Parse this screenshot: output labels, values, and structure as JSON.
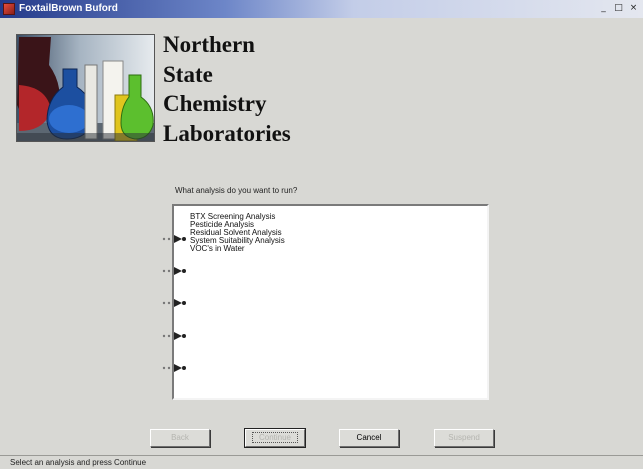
{
  "window": {
    "title": "FoxtailBrown Buford",
    "minimize": "_",
    "maximize": "□",
    "close": "×"
  },
  "logo": {
    "icon": "lab-flasks-image"
  },
  "company": {
    "lines": [
      "Northern",
      "State",
      "Chemistry",
      "Laboratories"
    ]
  },
  "prompt": "What analysis do you want to run?",
  "analyses": [
    "BTX Screening Analysis",
    "Pesticide Analysis",
    "Residual Solvent Analysis",
    "System Suitability Analysis",
    "VOC's in Water"
  ],
  "buttons": {
    "back": "Back",
    "continue": "Continue",
    "cancel": "Cancel",
    "suspend": "Suspend"
  },
  "status": "Select an analysis and press Continue",
  "colors": {
    "background": "#d8d8d4",
    "titlebar_start": "#243a8a",
    "titlebar_end": "#e4e7ef"
  }
}
